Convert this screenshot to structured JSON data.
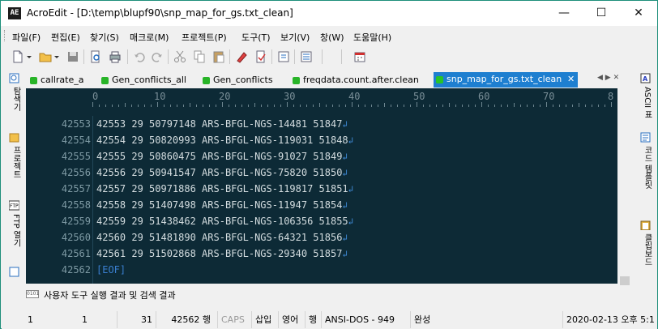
{
  "window": {
    "title": "AcroEdit - [D:\\temp\\blupf90\\snp_map_for_gs.txt_clean]",
    "app_icon_text": "AE",
    "controls": {
      "minimize": "—",
      "maximize": "☐",
      "close": "✕"
    }
  },
  "menu": {
    "items": [
      "파일(F)",
      "편집(E)",
      "찾기(S)",
      "매크로(M)",
      "프로젝트(P)",
      "도구(T)",
      "보기(V)",
      "창(W)",
      "도움말(H)"
    ]
  },
  "toolbar": {
    "icons": [
      "new-file-icon",
      "open-folder-icon",
      "save-icon",
      "print-preview-icon",
      "print-icon",
      "undo-icon",
      "redo-icon",
      "cut-icon",
      "copy-icon",
      "paste-icon",
      "highlighter-icon",
      "document-check-icon",
      "window-icon",
      "list-icon",
      "calendar-icon"
    ]
  },
  "left_panel": {
    "tabs": [
      "탐색기",
      "프로젝트",
      "FTP 열기"
    ]
  },
  "right_panel": {
    "tabs": [
      "ASCII 표",
      "코드 템플릿",
      "클립보드"
    ]
  },
  "tabs": [
    {
      "label": "callrate_a",
      "active": false
    },
    {
      "label": "Gen_conflicts_all",
      "active": false
    },
    {
      "label": "Gen_conflicts",
      "active": false
    },
    {
      "label": "freqdata.count.after.clean",
      "active": false
    },
    {
      "label": "snp_map_for_gs.txt_clean",
      "active": true
    }
  ],
  "tab_nav": {
    "prev": "◀",
    "next": "▶",
    "close": "✕"
  },
  "editor": {
    "ruler": [
      "0",
      "10",
      "20",
      "30",
      "40",
      "50",
      "60",
      "70",
      "8"
    ],
    "lines": [
      {
        "num": "42553",
        "text": "42553 29 50797148 ARS-BFGL-NGS-14481 51847",
        "newline": "↲"
      },
      {
        "num": "42554",
        "text": "42554 29 50820993 ARS-BFGL-NGS-119031 51848",
        "newline": "↲"
      },
      {
        "num": "42555",
        "text": "42555 29 50860475 ARS-BFGL-NGS-91027 51849",
        "newline": "↲"
      },
      {
        "num": "42556",
        "text": "42556 29 50941547 ARS-BFGL-NGS-75820 51850",
        "newline": "↲"
      },
      {
        "num": "42557",
        "text": "42557 29 50971886 ARS-BFGL-NGS-119817 51851",
        "newline": "↲"
      },
      {
        "num": "42558",
        "text": "42558 29 51407498 ARS-BFGL-NGS-11947 51854",
        "newline": "↲"
      },
      {
        "num": "42559",
        "text": "42559 29 51438462 ARS-BFGL-NGS-106356 51855",
        "newline": "↲"
      },
      {
        "num": "42560",
        "text": "42560 29 51481890 ARS-BFGL-NGS-64321 51856",
        "newline": "↲"
      },
      {
        "num": "42561",
        "text": "42561 29 51502868 ARS-BFGL-NGS-29340 51857",
        "newline": "↲"
      },
      {
        "num": "42562",
        "text": "[EOF]",
        "newline": ""
      }
    ]
  },
  "output_pane": {
    "label": "사용자 도구 실행 결과 및 검색 결과"
  },
  "status_bar": {
    "col": "1",
    "line_in_view": "1",
    "pos": "31",
    "line_total": "42562 행",
    "caps": "CAPS",
    "insert": "삽입",
    "lang": "영어",
    "unit": "행",
    "encoding": "ANSI-DOS - 949",
    "state": "완성",
    "datetime": "2020-02-13 오후 5:1"
  },
  "colors": {
    "editor_bg": "#0d2a36",
    "active_tab": "#1e7fd0",
    "tab_dot": "#28b428",
    "eof": "#3a7fd0"
  }
}
